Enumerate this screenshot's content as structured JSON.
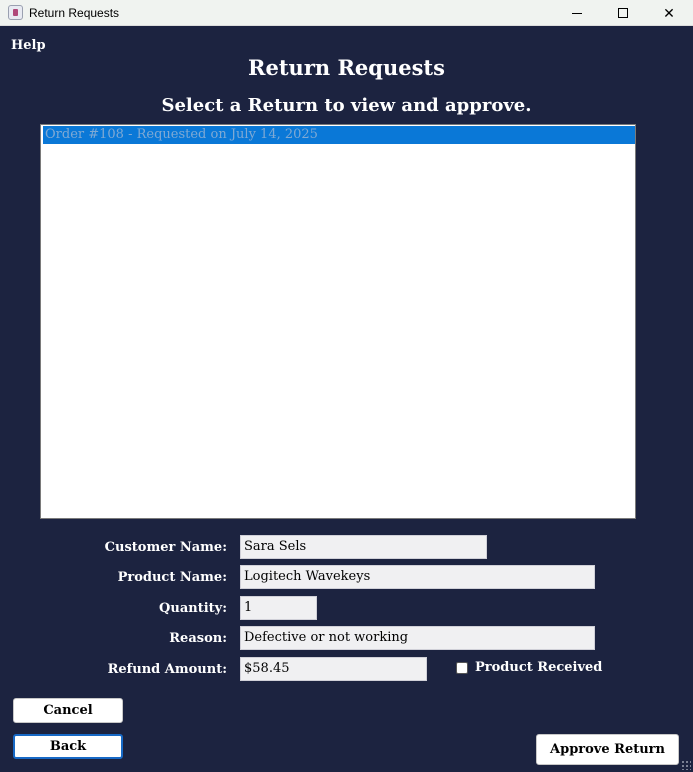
{
  "window": {
    "title": "Return Requests",
    "controls": [
      "minimize",
      "maximize",
      "close"
    ],
    "close_glyph": "✕"
  },
  "menu": {
    "help": "Help"
  },
  "header": {
    "title": "Return Requests",
    "subtitle": "Select a Return to view and approve."
  },
  "returns_list": {
    "items": [
      {
        "label": "Order #108 - Requested on July 14, 2025",
        "selected": true
      }
    ]
  },
  "details": {
    "customer_name": {
      "label": "Customer Name:",
      "value": "Sara Sels"
    },
    "product_name": {
      "label": "Product Name:",
      "value": "Logitech Wavekeys"
    },
    "quantity": {
      "label": "Quantity:",
      "value": "1"
    },
    "reason": {
      "label": "Reason:",
      "value": "Defective or not working"
    },
    "refund_amount": {
      "label": "Refund Amount:",
      "value": "$58.45"
    },
    "product_received": {
      "label": "Product Received",
      "checked": false
    }
  },
  "buttons": {
    "cancel": "Cancel",
    "back": "Back",
    "approve": "Approve Return"
  },
  "colors": {
    "background": "#1c2340",
    "selection": "#0a78d7",
    "focus_border": "#1769c6"
  }
}
